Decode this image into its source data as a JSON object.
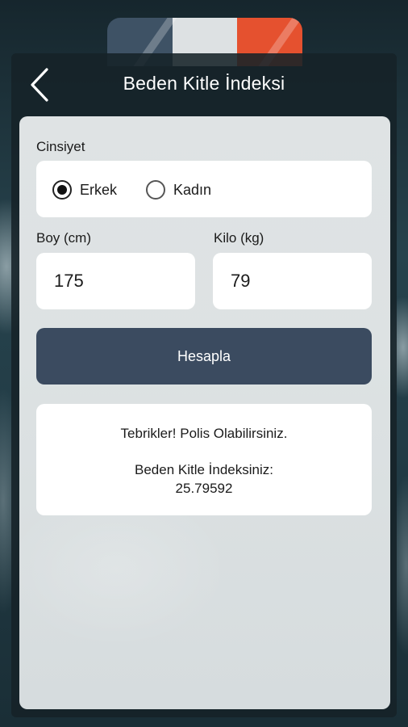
{
  "header": {
    "title": "Beden Kitle İndeksi",
    "back_icon": "chevron-left-icon"
  },
  "form": {
    "gender_label": "Cinsiyet",
    "gender_options": [
      {
        "label": "Erkek",
        "selected": true
      },
      {
        "label": "Kadın",
        "selected": false
      }
    ],
    "height_label": "Boy (cm)",
    "height_value": "175",
    "weight_label": "Kilo (kg)",
    "weight_value": "79",
    "calculate_label": "Hesapla"
  },
  "result": {
    "message": "Tebrikler! Polis Olabilirsiniz.",
    "bmi_label": "Beden Kitle İndeksiniz:",
    "bmi_value": "25.79592"
  },
  "colors": {
    "button": "#3b4b60",
    "card": "#dfe3e4",
    "flag_blue": "#3e5265",
    "flag_white": "#dde1e3",
    "flag_red": "#e5512f"
  }
}
